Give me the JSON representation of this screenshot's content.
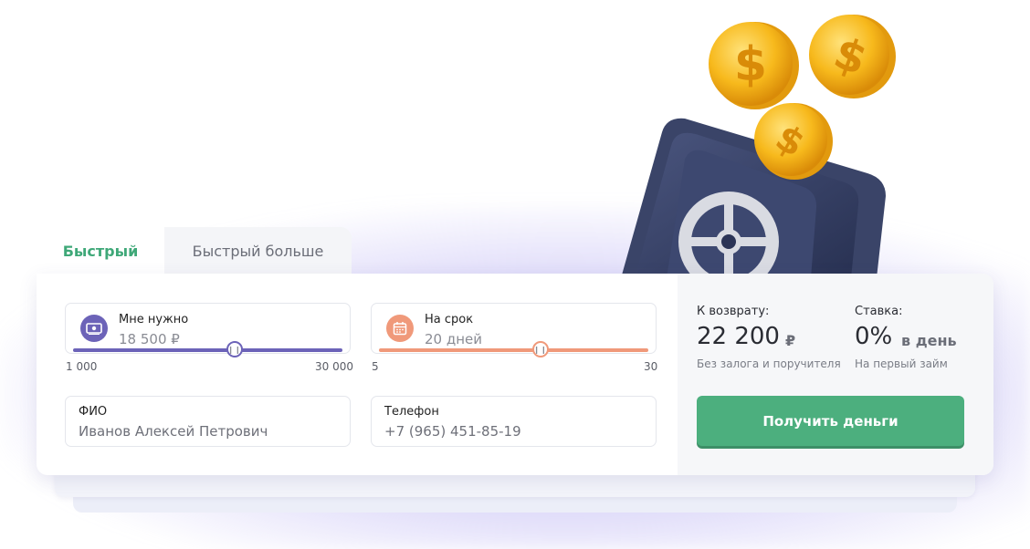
{
  "tabs": [
    {
      "label": "Быстрый",
      "active": true
    },
    {
      "label": "Быстрый больше",
      "active": false
    }
  ],
  "amount": {
    "label": "Мне нужно",
    "value": "18 500 ₽",
    "min_label": "1 000",
    "max_label": "30 000",
    "fraction": 0.6,
    "icon": "money-icon",
    "color": "#6c63b8"
  },
  "term": {
    "label": "На срок",
    "value": "20 дней",
    "min_label": "5",
    "max_label": "30",
    "fraction": 0.6,
    "icon": "calendar-icon",
    "color": "#f0997a"
  },
  "name_field": {
    "label": "ФИО",
    "value": "Иванов Алексей Петрович"
  },
  "phone_field": {
    "label": "Телефон",
    "value": "+7 (965) 451-85-19"
  },
  "summary": {
    "return_label": "К возврату:",
    "return_value": "22 200",
    "return_currency": "₽",
    "return_note": "Без залога и поручителя",
    "rate_label": "Ставка:",
    "rate_value": "0%",
    "rate_unit": "в день",
    "rate_note": "На первый займ"
  },
  "cta_label": "Получить деньги",
  "colors": {
    "accent_green": "#4caf7e",
    "purple": "#6c63b8",
    "salmon": "#f0997a"
  }
}
